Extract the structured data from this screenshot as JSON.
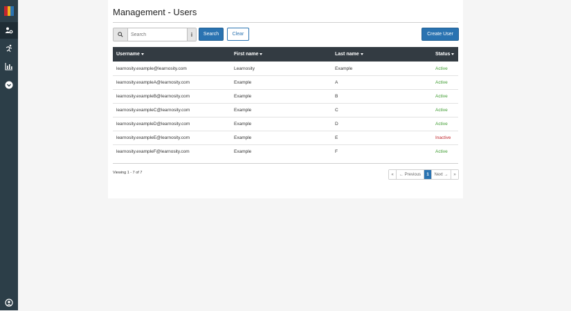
{
  "brand_colors": [
    "#c4262e",
    "#f2b51d",
    "#2a73b1"
  ],
  "sidebar": {
    "items": [
      {
        "icon": "users-gear-icon",
        "active": true
      },
      {
        "icon": "running-person-icon",
        "active": false
      },
      {
        "icon": "bar-chart-icon",
        "active": false
      },
      {
        "icon": "chevron-down-circle-icon",
        "active": false
      }
    ],
    "bottom_icon": "user-circle-icon"
  },
  "page": {
    "title": "Management - Users"
  },
  "search": {
    "placeholder": "Search",
    "value": "",
    "info_label": "i",
    "search_button": "Search",
    "clear_button": "Clear"
  },
  "create_button": "Create User",
  "table": {
    "columns": [
      "Username",
      "First name",
      "Last name",
      "Status"
    ],
    "rows": [
      {
        "username": "learnosity.example@learnosity.com",
        "first": "Learnosity",
        "last": "Example",
        "status": "Active"
      },
      {
        "username": "learnosity.exampleA@learnosity.com",
        "first": "Example",
        "last": "A",
        "status": "Active"
      },
      {
        "username": "learnosity.exampleB@learnosity.com",
        "first": "Example",
        "last": "B",
        "status": "Active"
      },
      {
        "username": "learnosity.exampleC@learnosity.com",
        "first": "Example",
        "last": "C",
        "status": "Active"
      },
      {
        "username": "learnosity.exampleD@learnosity.com",
        "first": "Example",
        "last": "D",
        "status": "Active"
      },
      {
        "username": "learnosity.exampleE@learnosity.com",
        "first": "Example",
        "last": "E",
        "status": "Inactive"
      },
      {
        "username": "learnosity.exampleF@learnosity.com",
        "first": "Example",
        "last": "F",
        "status": "Active"
      }
    ]
  },
  "footer": {
    "viewing": "Viewing 1 - 7 of 7"
  },
  "pagination": {
    "first": "«",
    "previous": "← Previous",
    "current": "1",
    "next": "Next →",
    "last": "»"
  },
  "colors": {
    "active": "#3d9b2f",
    "inactive": "#c0262c",
    "primary": "#2a73b1",
    "header_bg": "#333b42",
    "sidebar_bg": "#2c3e48"
  }
}
